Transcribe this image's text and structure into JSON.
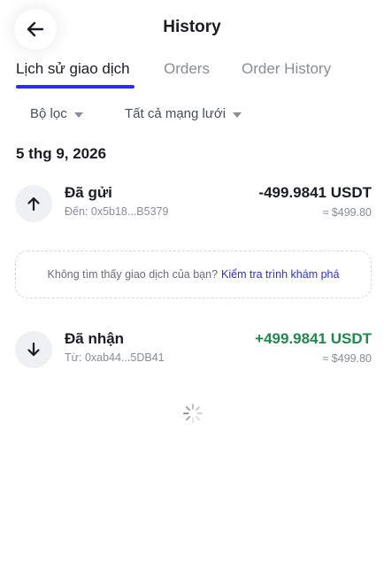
{
  "header": {
    "title": "History",
    "back_icon": "arrow-left-icon"
  },
  "tabs": [
    {
      "label": "Lịch sử giao dịch",
      "active": true
    },
    {
      "label": "Orders",
      "active": false
    },
    {
      "label": "Order History",
      "active": false
    }
  ],
  "filters": {
    "filter_label": "Bộ lọc",
    "network_label": "Tất cả mạng lưới"
  },
  "date_heading": "5 thg 9, 2026",
  "transactions": [
    {
      "title": "Đã gửi",
      "address": "Đến: 0x5b18...B5379",
      "amount": "-499.9841 USDT",
      "fiat": "≈ $499.80",
      "direction_icon": "arrow-up-icon"
    },
    {
      "title": "Đã nhận",
      "address": "Từ: 0xab44...5DB41",
      "amount": "+499.9841 USDT",
      "fiat": "≈ $499.80",
      "direction_icon": "arrow-down-icon"
    }
  ],
  "notice": {
    "text": "Không tìm thấy giao dịch của bạn?",
    "link": "Kiểm tra trình khám phá"
  },
  "colors": {
    "accent": "#2b2fe6",
    "positive": "#1e8a4c",
    "muted": "#8a8d95"
  }
}
